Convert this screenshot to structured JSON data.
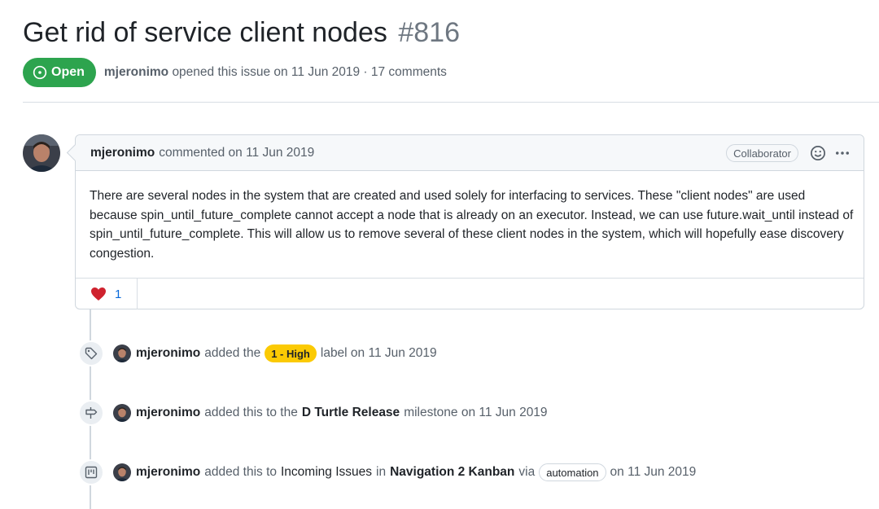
{
  "issue": {
    "title": "Get rid of service client nodes",
    "number": "#816",
    "state": "Open",
    "state_color": "#2da44e",
    "author": "mjeronimo",
    "opened_text": "opened this issue on 11 Jun 2019 · 17 comments"
  },
  "comment": {
    "author": "mjeronimo",
    "meta": "commented on 11 Jun 2019",
    "role_badge": "Collaborator",
    "body": "There are several nodes in the system that are created and used solely for interfacing to services. These \"client nodes\" are used because spin_until_future_complete cannot accept a node that is already on an executor. Instead, we can use future.wait_until instead of spin_until_future_complete. This will allow us to remove several of these client nodes in the system, which will hopefully ease discovery congestion.",
    "reactions": [
      {
        "icon": "heart-icon",
        "count": "1",
        "color": "#cf222e"
      }
    ]
  },
  "timeline": [
    {
      "icon": "tag-icon",
      "author": "mjeronimo",
      "prefix": "added the",
      "label": "1 - High",
      "label_color": "#fbca04",
      "suffix": "label on 11 Jun 2019"
    },
    {
      "icon": "milestone-icon",
      "author": "mjeronimo",
      "prefix": "added this to the",
      "milestone": "D Turtle Release",
      "suffix": "milestone on 11 Jun 2019"
    },
    {
      "icon": "project-icon",
      "author": "mjeronimo",
      "prefix": "added this to",
      "column": "Incoming Issues",
      "in_text": "in",
      "project": "Navigation 2 Kanban",
      "via_text": "via",
      "via_badge": "automation",
      "suffix": "on 11 Jun 2019"
    }
  ]
}
